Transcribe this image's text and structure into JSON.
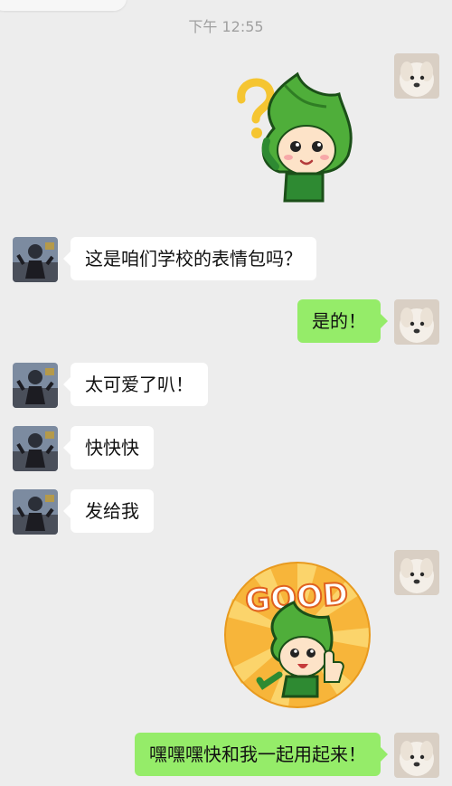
{
  "header": {
    "time": "下午 12:55"
  },
  "colors": {
    "background": "#ededed",
    "self_bubble": "#95ec69",
    "other_bubble": "#ffffff",
    "leaf_green": "#4fae3a"
  },
  "messages": [
    {
      "side": "right",
      "type": "sticker",
      "sticker_name": "leaf-mascot-question-sticker"
    },
    {
      "side": "left",
      "type": "text",
      "text": "这是咱们学校的表情包吗？"
    },
    {
      "side": "right",
      "type": "text",
      "text": "是的！"
    },
    {
      "side": "left",
      "type": "text",
      "text": "太可爱了叭！"
    },
    {
      "side": "left",
      "type": "text",
      "text": "快快快"
    },
    {
      "side": "left",
      "type": "text",
      "text": "发给我"
    },
    {
      "side": "right",
      "type": "sticker",
      "sticker_name": "leaf-mascot-good-sticker",
      "sticker_text": "GOOD"
    },
    {
      "side": "right",
      "type": "text",
      "text": "嘿嘿嘿快和我一起用起来！"
    }
  ]
}
